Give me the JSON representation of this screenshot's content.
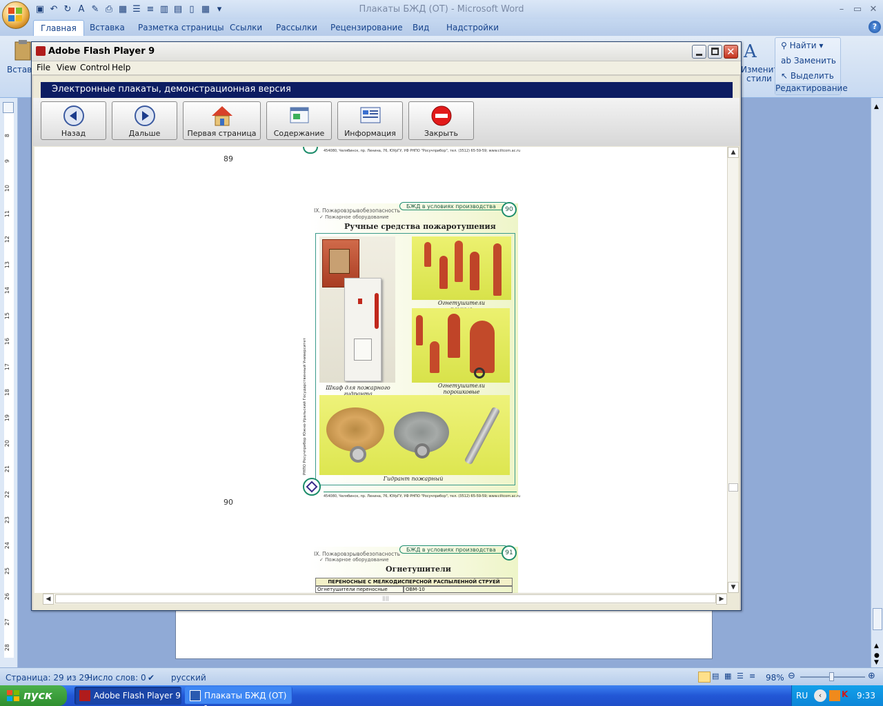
{
  "word": {
    "title": "Плакаты БЖД (ОТ) - Microsoft Word",
    "tabs": [
      "Главная",
      "Вставка",
      "Разметка страницы",
      "Ссылки",
      "Рассылки",
      "Рецензирование",
      "Вид",
      "Надстройки"
    ],
    "ribbon": {
      "paste_label": "Вставить",
      "styles_label_1": "Изменить",
      "styles_label_2": "стили",
      "editing": {
        "find": "Найти",
        "replace": "Заменить",
        "select": "Выделить",
        "group_label": "Редактирование"
      }
    },
    "status": {
      "page": "Страница: 29 из 29",
      "words": "Число слов: 0",
      "language": "русский",
      "zoom": "98%"
    }
  },
  "flash": {
    "title": "Adobe Flash Player 9",
    "menu": [
      "File",
      "View",
      "Control",
      "Help"
    ],
    "header": "Электронные плакаты, демонстрационная версия",
    "buttons": {
      "back": "Назад",
      "next": "Дальше",
      "home": "Первая страница",
      "contents": "Содержание",
      "info": "Информация",
      "close": "Закрыть"
    },
    "pages": {
      "p89_num": "89",
      "p89_footer": "454080, Челябинск, пр. Ленина, 76, ЮУрГУ, УФ РНПО \"Росучприбор\", тел. (3512) 65-59-59; www.ciltcom.ac.ru",
      "p90_num": "90",
      "p90_page_badge": "90",
      "p90_section": "IX.  Пожаровзрывобезопасность",
      "p90_subsection": "✓ Пожарное оборудование",
      "p90_series": "БЖД  в  условиях  производства",
      "p90_title": "Ручные   средства   пожаротушения",
      "p90_caption_cabinet": "Шкаф для пожарного гидранта",
      "p90_caption_foam": "Огнетушители пенные",
      "p90_caption_powder": "Огнетушители порошковые",
      "p90_caption_hydrant": "Гидрант пожарный",
      "p90_side_text": "РНПО Росучприбор     Южно-Уральский Государственный Университет",
      "p90_footer": "454080, Челябинск, пр. Ленина, 76, ЮУрГУ, УФ РНПО \"Росучприбор\", тел. (3512) 65-59-59; www.ciltcom.ac.ru",
      "p91_page_badge": "91",
      "p91_section": "IX.  Пожаровзрывобезопасность",
      "p91_subsection": "✓ Пожарное оборудование",
      "p91_series": "БЖД  в  условиях  производства",
      "p91_title": "Огнетушители",
      "p91_table_header": "ПЕРЕНОСНЫЕ С МЕЛКОДИСПЕРСНОЙ РАСПЫЛЕННОЙ СТРУЕЙ",
      "p91_row_label": "Огнетушители переносные",
      "p91_row_value": "ОВМ-10"
    }
  },
  "taskbar": {
    "start": "пуск",
    "tasks": [
      "Adobe Flash Player 9",
      "Плакаты БЖД (ОТ) -..."
    ],
    "lang": "RU",
    "time": "9:33"
  },
  "ruler_numbers": [
    "8",
    "9",
    "10",
    "11",
    "12",
    "13",
    "14",
    "15",
    "16",
    "17",
    "18",
    "19",
    "20",
    "21",
    "22",
    "23",
    "24",
    "25",
    "26",
    "27",
    "28"
  ]
}
